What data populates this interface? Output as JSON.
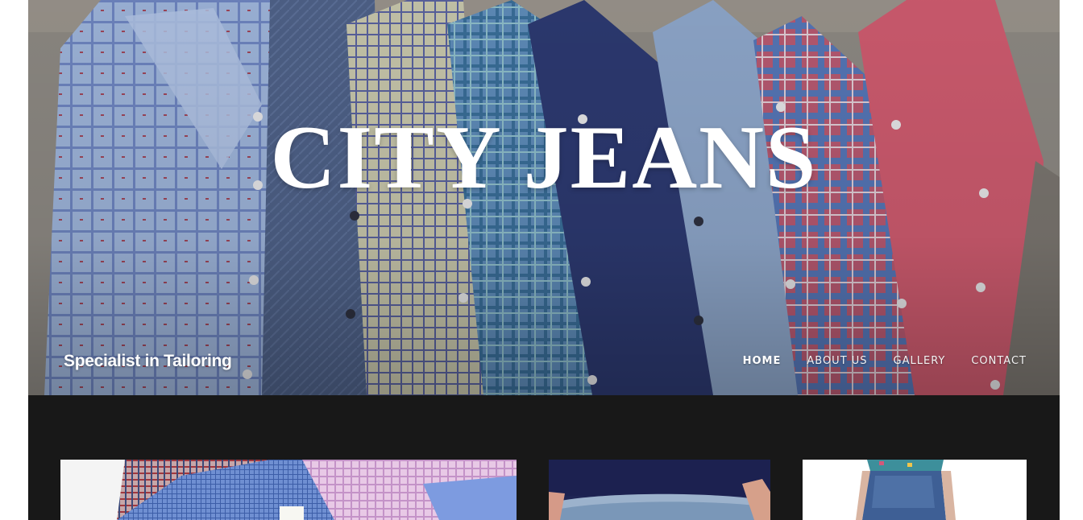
{
  "site": {
    "brand": "CITY JEANS",
    "tagline": "Specialist in Tailoring"
  },
  "nav": {
    "items": [
      {
        "label": "HOME",
        "active": true
      },
      {
        "label": "ABOUT US",
        "active": false
      },
      {
        "label": "GALLERY",
        "active": false
      },
      {
        "label": "CONTACT",
        "active": false
      }
    ]
  },
  "hero": {
    "image": "folded-dress-shirts-photo"
  },
  "gallery": {
    "cards": [
      {
        "image": "checked-shirts-photo"
      },
      {
        "image": "denim-jeans-waist-photo"
      },
      {
        "image": "denim-shorts-model-photo"
      }
    ]
  },
  "colors": {
    "content_background": "#181818",
    "text": "#ffffff"
  }
}
